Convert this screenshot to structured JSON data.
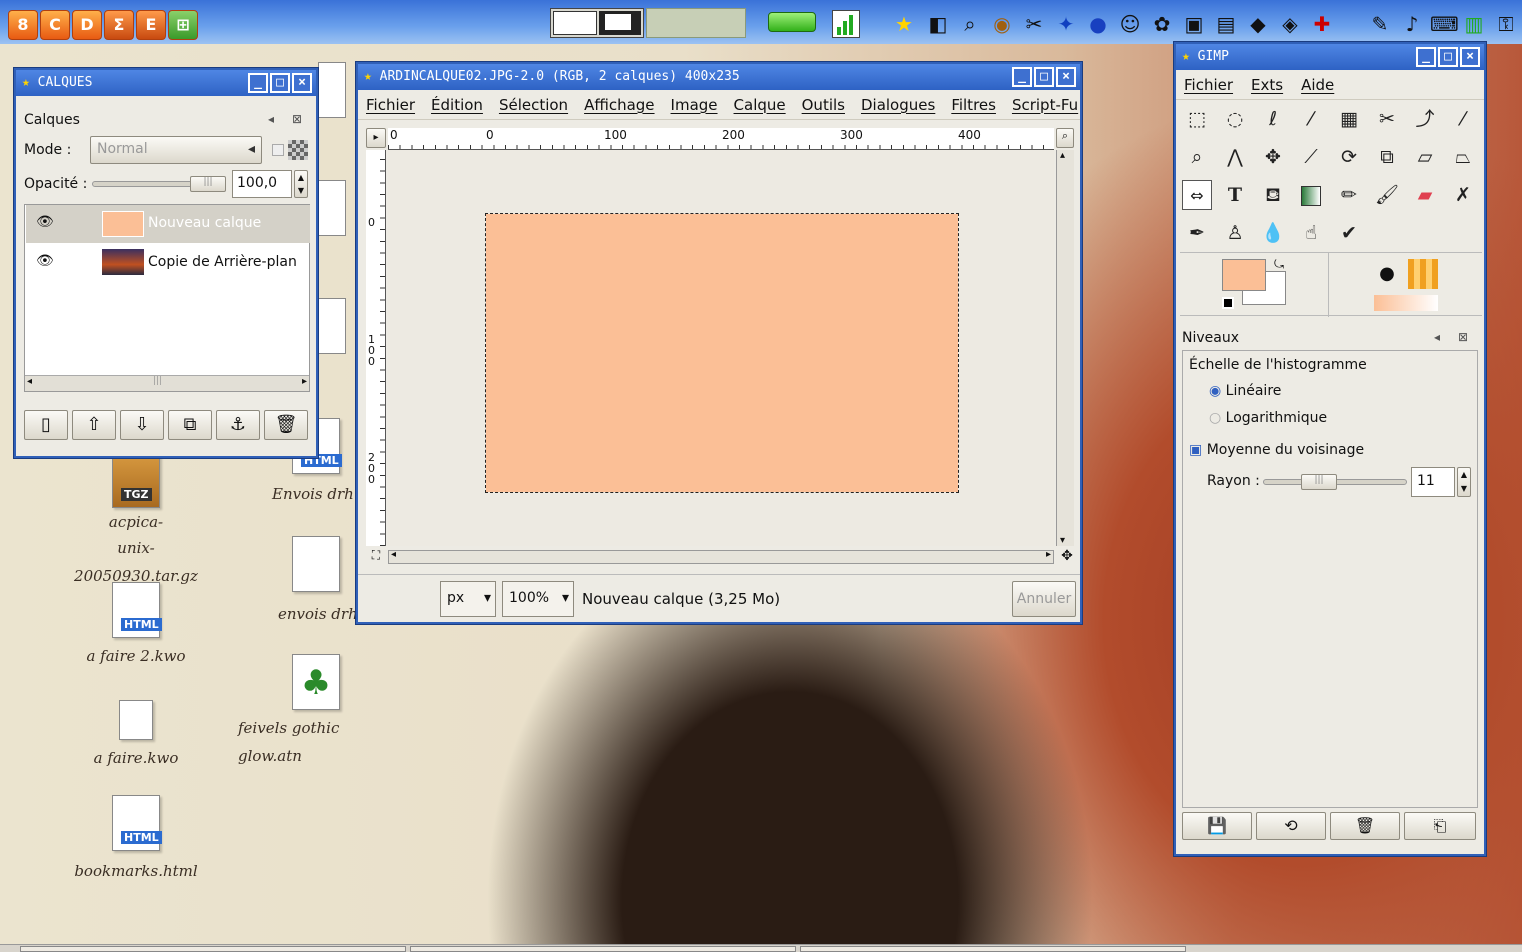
{
  "desktop": {
    "icons": [
      {
        "label1": "acpica-",
        "label2": "unix-20050930.tar.gz",
        "badge": "TGZ"
      },
      {
        "label1": "a faire 2.kwo",
        "badge": "HTML"
      },
      {
        "label1": "a faire.kwo"
      },
      {
        "label1": "bookmarks.html",
        "badge": "HTML"
      },
      {
        "label1": "envois drh.",
        "partial": true
      },
      {
        "label1": "Envois drh.",
        "badge": "HTML"
      },
      {
        "label1": "feivels gothic glow.atn"
      }
    ]
  },
  "layers": {
    "title": "CALQUES",
    "section_title": "Calques",
    "mode_label": "Mode :",
    "mode_value": "Normal",
    "opacity_label": "Opacité :",
    "opacity_value": "100,0",
    "items": [
      {
        "name": "Nouveau calque",
        "selected": true
      },
      {
        "name": "Copie de Arrière-plan",
        "selected": false
      }
    ],
    "icons": [
      "new-layer-icon",
      "raise-layer-icon",
      "lower-layer-icon",
      "duplicate-layer-icon",
      "anchor-layer-icon",
      "delete-layer-icon"
    ]
  },
  "image": {
    "title": "ARDINCALQUE02.JPG-2.0 (RGB, 2 calques) 400x235",
    "menu": [
      "Fichier",
      "Édition",
      "Sélection",
      "Affichage",
      "Image",
      "Calque",
      "Outils",
      "Dialogues",
      "Filtres",
      "Script-Fu"
    ],
    "ruler_h": [
      "0",
      "100",
      "200",
      "300",
      "400"
    ],
    "ruler_v": [
      "0",
      "100",
      "200"
    ],
    "unit": "px",
    "zoom": "100%",
    "status": "Nouveau calque (3,25 Mo)",
    "cancel": "Annuler",
    "layer_color": "#fbbf96"
  },
  "gimp": {
    "title": "GIMP",
    "menu": [
      "Fichier",
      "Exts",
      "Aide"
    ],
    "fg_color": "#fbbf96",
    "bg_color": "#ffffff",
    "tools": [
      "rect-select-icon",
      "ellipse-select-icon",
      "lasso-icon",
      "magic-wand-icon",
      "color-select-icon",
      "scissors-icon",
      "paths-icon",
      "color-picker-icon",
      "zoom-icon",
      "measure-icon",
      "move-icon",
      "crop-icon",
      "rotate-icon",
      "scale-icon",
      "shear-icon",
      "perspective-icon",
      "flip-icon",
      "text-icon",
      "bucket-fill-icon",
      "blend-icon",
      "pencil-icon",
      "paintbrush-icon",
      "eraser-icon",
      "airbrush-icon",
      "ink-icon",
      "clone-icon",
      "blur-icon",
      "smudge-icon",
      "dodge-burn-icon"
    ]
  },
  "levels": {
    "title": "Niveaux",
    "section": "Échelle de l'histogramme",
    "linear": "Linéaire",
    "log": "Logarithmique",
    "avg": "Moyenne du voisinage",
    "radius_label": "Rayon :",
    "radius_value": "11",
    "icons": [
      "save-icon",
      "refresh-icon",
      "delete-icon",
      "restore-icon"
    ]
  }
}
